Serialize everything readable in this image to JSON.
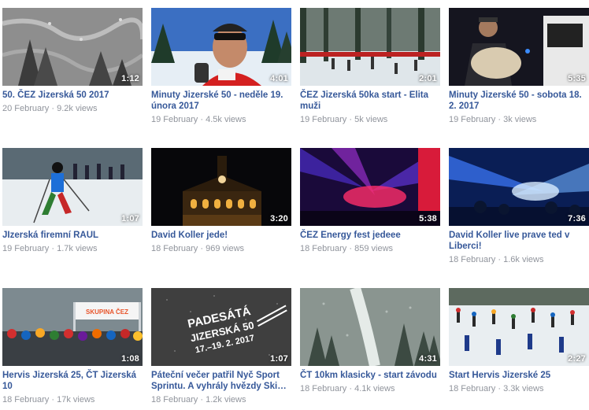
{
  "videos": [
    {
      "title": "50. ČEZ Jizerská 50 2017",
      "date": "20 February",
      "views": "9.2k views",
      "duration": "1:12",
      "scene": "aerial-snow-forest"
    },
    {
      "title": "Minuty Jizerské 50 - neděle 19. února 2017",
      "date": "19 February",
      "views": "4.5k views",
      "duration": "4:01",
      "scene": "man-sunglasses-selfie"
    },
    {
      "title": "ČEZ Jizerská 50ka start - Elita muži",
      "date": "19 February",
      "views": "5k views",
      "duration": "2:01",
      "scene": "skiers-race-start"
    },
    {
      "title": "Minuty Jizerské 50 - sobota 18. 2. 2017",
      "date": "19 February",
      "views": "3k views",
      "duration": "5:35",
      "scene": "person-night-car"
    },
    {
      "title": "JIzerská firemní RAUL",
      "date": "19 February",
      "views": "1.7k views",
      "duration": "1:07",
      "scene": "skier-on-course"
    },
    {
      "title": "David Koller jede!",
      "date": "18 February",
      "views": "969 views",
      "duration": "3:20",
      "scene": "town-hall-night"
    },
    {
      "title": "ČEZ Energy fest jedeee",
      "date": "18 February",
      "views": "859 views",
      "duration": "5:38",
      "scene": "concert-stage-lights"
    },
    {
      "title": "David Koller live prave ted v Liberci!",
      "date": "18 February",
      "views": "1.6k views",
      "duration": "7:36",
      "scene": "concert-blue-lights"
    },
    {
      "title": "Hervis Jizerská 25, ČT Jizerská 10",
      "date": "18 February",
      "views": "17k views",
      "duration": "1:08",
      "scene": "crowd-skupina-cez"
    },
    {
      "title": "Páteční večer patřil Nyč Sport Sprintu. A vyhrály hvězdy Ski…",
      "date": "18 February",
      "views": "1.2k views",
      "duration": "1:07",
      "scene": "padesata-logo",
      "overlay_text": [
        "PADESÁTÁ",
        "JIZERSKÁ 50",
        "17.–19. 2. 2017"
      ]
    },
    {
      "title": "ČT 10km klasicky - start závodu",
      "date": "18 February",
      "views": "4.1k views",
      "duration": "4:31",
      "scene": "snowy-forest-aerial"
    },
    {
      "title": "Start Hervis Jizerské 25",
      "date": "18 February",
      "views": "3.3k views",
      "duration": "2:27",
      "scene": "skiers-crowd-start"
    }
  ],
  "thumb_extra": {
    "skupina_sign": "SKUPINA ČEZ"
  },
  "colors": {
    "title_link": "#365899",
    "meta_text": "#90949c"
  }
}
